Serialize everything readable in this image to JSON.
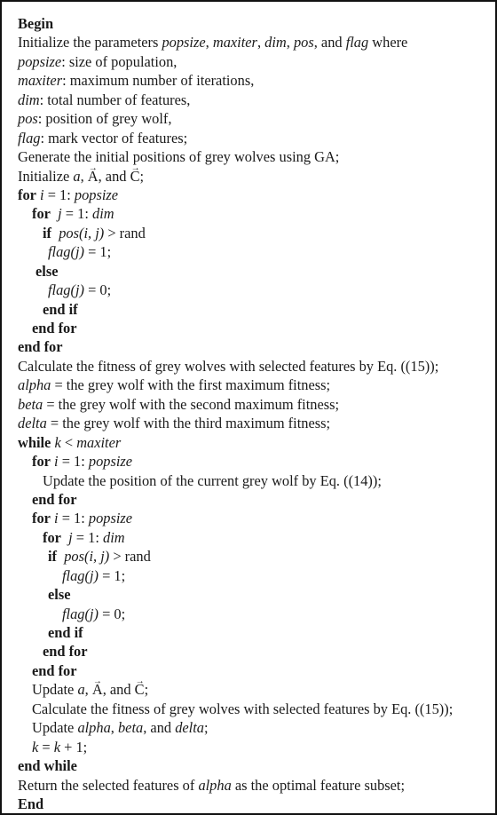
{
  "algorithm": {
    "keywords": {
      "begin": "Begin",
      "end": "End",
      "for": "for",
      "end_for": "end for",
      "if": "if",
      "else": "else",
      "end_if": "end if",
      "while": "while",
      "end_while": "end while"
    },
    "init_params": {
      "prefix": "Initialize the parameters ",
      "params": [
        "popsize",
        "maxiter",
        "dim",
        "pos",
        "flag"
      ],
      "sep": ", ",
      "and": ", and ",
      "suffix": " where"
    },
    "definitions": [
      {
        "term": "popsize",
        "desc": ": size of population,"
      },
      {
        "term": "maxiter",
        "desc": ": maximum number of iterations,"
      },
      {
        "term": "dim",
        "desc": ": total number of features,"
      },
      {
        "term": "pos",
        "desc": ": position of grey wolf,"
      },
      {
        "term": "flag",
        "desc": ": mark vector of features;"
      }
    ],
    "generate_initial": "Generate the initial positions of grey wolves using GA;",
    "initialize_aac": {
      "prefix": "Initialize ",
      "a": "a",
      "A": "A",
      "C": "C",
      "sep": ", ",
      "and": ", and ",
      "end": ";"
    },
    "update_aac": {
      "prefix": "Update ",
      "a": "a",
      "A": "A",
      "C": "C",
      "sep": ", ",
      "and": ", and ",
      "end": ";"
    },
    "loop_i": {
      "var": "i",
      "eq": " = 1: ",
      "limit": "popsize"
    },
    "loop_j": {
      "var": "j",
      "eq": " = 1: ",
      "limit": "dim"
    },
    "condition": {
      "expr": "pos(i, j)",
      "op": " > rand"
    },
    "flag_set1": {
      "expr": "flag(j)",
      "rhs": " = 1;"
    },
    "flag_set0": {
      "expr": "flag(j)",
      "rhs": " = 0;"
    },
    "calc_fitness": "Calculate the fitness of grey wolves with selected features by Eq. ((15));",
    "leaders": [
      {
        "name": "alpha",
        "desc": " = the grey wolf with the first maximum fitness;"
      },
      {
        "name": "beta",
        "desc": " = the grey wolf with the second maximum fitness;"
      },
      {
        "name": "delta",
        "desc": " = the grey wolf with the third maximum fitness;"
      }
    ],
    "while_cond": {
      "var": "k",
      "op": " < ",
      "limit": "maxiter"
    },
    "update_position": "Update the position of the current grey wolf by Eq. ((14));",
    "update_leaders": {
      "prefix": "Update ",
      "alpha": "alpha",
      "beta": "beta",
      "delta": "delta",
      "sep": ", ",
      "and": ", and ",
      "end": ";"
    },
    "increment": {
      "var": "k",
      "eq": " = ",
      "var2": "k",
      "rest": " + 1;"
    },
    "return": {
      "prefix": "Return the selected features of ",
      "name": "alpha",
      "suffix": " as the optimal feature subset;"
    }
  }
}
